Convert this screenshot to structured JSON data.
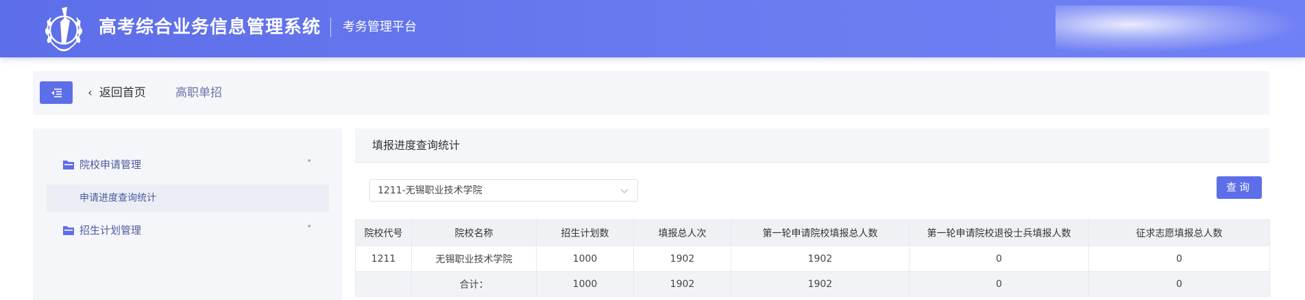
{
  "header": {
    "title": "高考综合业务信息管理系统",
    "subtitle": "考务管理平台"
  },
  "breadcrumb": {
    "back_label": "返回首页",
    "current": "高职单招"
  },
  "sidebar": {
    "groups": [
      {
        "label": "院校申请管理",
        "expanded": true,
        "items": [
          {
            "label": "申请进度查询统计",
            "active": true
          }
        ]
      },
      {
        "label": "招生计划管理",
        "expanded": false,
        "items": []
      }
    ]
  },
  "panel": {
    "title": "填报进度查询统计",
    "select_value": "1211-无锡职业技术学院",
    "query_label": "查询"
  },
  "table": {
    "headers": [
      "院校代号",
      "院校名称",
      "招生计划数",
      "填报总人次",
      "第一轮申请院校填报总人数",
      "第一轮申请院校退役士兵填报人数",
      "征求志愿填报总人数"
    ],
    "rows": [
      [
        "1211",
        "无锡职业技术学院",
        "1000",
        "1902",
        "1902",
        "0",
        "0"
      ]
    ],
    "total": {
      "label": "合计：",
      "values": [
        "1000",
        "1902",
        "1902",
        "0",
        "0"
      ]
    }
  },
  "colors": {
    "brand": "#5d6ee9",
    "sidebar_text": "#4d5aa0",
    "panel_bg": "#f5f6f9"
  },
  "icons": {
    "logo": "university-emblem",
    "menu_toggle": "menu-indent-icon",
    "back": "chevron-left-icon",
    "group": "folder-icon",
    "expanded": "chevron-up-icon",
    "collapsed": "chevron-down-icon",
    "select": "chevron-down-icon"
  }
}
